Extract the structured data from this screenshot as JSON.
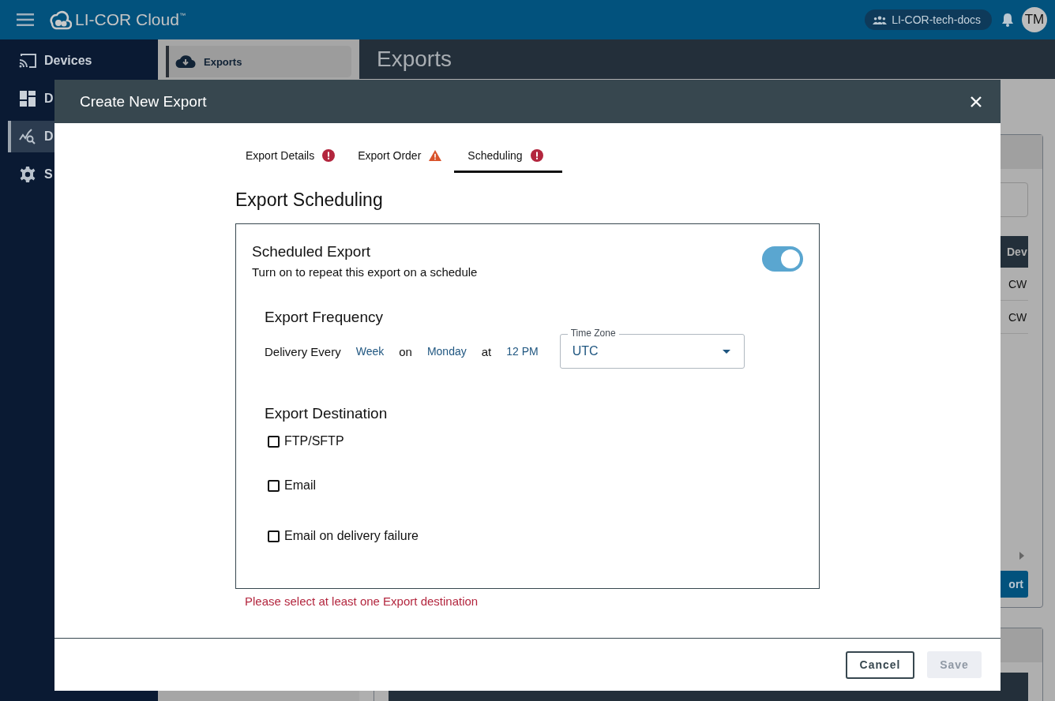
{
  "app": {
    "title": "LI-COR Cloud",
    "trademark": "™",
    "org": "LI-COR-tech-docs",
    "avatar": "TM"
  },
  "sidebar": {
    "items": [
      {
        "label": "Devices",
        "kind": "cast",
        "selected": false
      },
      {
        "label": "D",
        "kind": "dashboard",
        "selected": false
      },
      {
        "label": "D",
        "kind": "chart",
        "selected": true
      },
      {
        "label": "S",
        "kind": "gear",
        "selected": false
      }
    ]
  },
  "subnav": {
    "items": [
      {
        "label": "Exports",
        "selected": true
      }
    ]
  },
  "page": {
    "title": "Exports",
    "table": {
      "column_1": "Dev",
      "rows": [
        "CW",
        "CW"
      ]
    },
    "button": "ort"
  },
  "dialog": {
    "title": "Create New Export",
    "tabs": [
      {
        "label": "Export Details",
        "kind": "error",
        "selected": false
      },
      {
        "label": "Export Order",
        "kind": "warning",
        "selected": false
      },
      {
        "label": "Scheduling",
        "kind": "error",
        "selected": true
      }
    ],
    "heading": "Export Scheduling",
    "scheduled": {
      "title": "Scheduled Export",
      "description": "Turn on to repeat this export on a schedule",
      "on": true
    },
    "frequency": {
      "heading": "Export Frequency",
      "label": "Delivery Every",
      "interval": "Week",
      "on_word": "on",
      "day": "Monday",
      "at_word": "at",
      "time": "12 PM",
      "timezone": {
        "label": "Time Zone",
        "value": "UTC"
      }
    },
    "destination": {
      "heading": "Export Destination",
      "options": [
        {
          "label": "FTP/SFTP",
          "checked": false
        },
        {
          "label": "Email",
          "checked": false
        },
        {
          "label": "Email on delivery failure",
          "checked": false
        }
      ]
    },
    "error": "Please select at least one Export destination",
    "buttons": {
      "cancel": "Cancel",
      "save": "Save",
      "save_disabled": true
    }
  }
}
